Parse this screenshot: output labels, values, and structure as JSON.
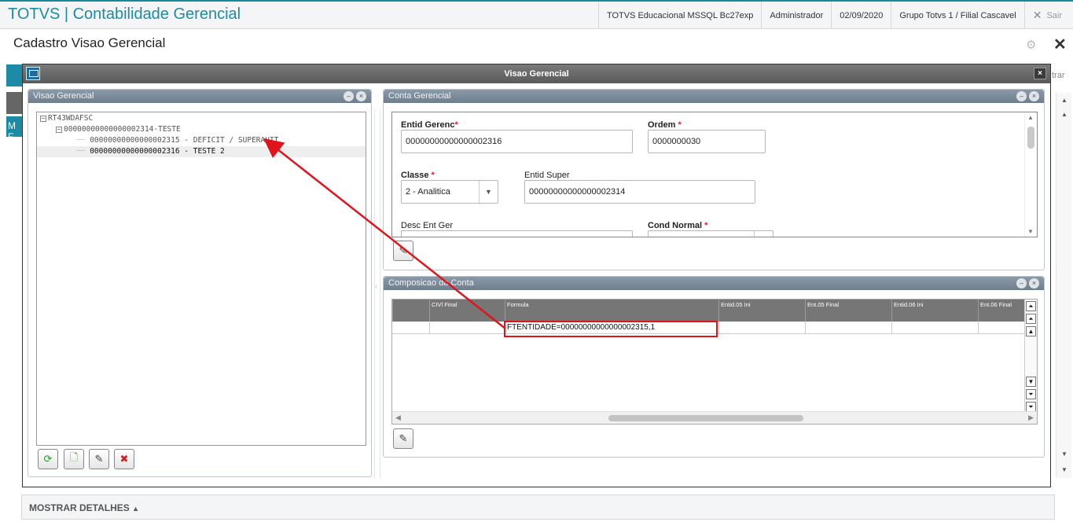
{
  "app": {
    "title": "TOTVS | Contabilidade Gerencial",
    "environment": "TOTVS Educacional MSSQL Bc27exp",
    "user": "Administrador",
    "date": "02/09/2020",
    "branch": "Grupo Totvs 1 / Filial Cascavel",
    "exit_label": "Sair"
  },
  "page": {
    "title": "Cadastro Visao Gerencial",
    "bg_partial_m": "M F",
    "bg_partial_trar": "trar"
  },
  "dialog": {
    "title": "Visao Gerencial",
    "close_glyph": "×"
  },
  "tree_panel": {
    "title": "Visao Gerencial",
    "nodes": [
      {
        "label": "RT43WDAFSC",
        "expander": "−"
      },
      {
        "label": "00000000000000002314-TESTE",
        "expander": "−"
      },
      {
        "label": "00000000000000002315 - DEFICIT / SUPERAVIT"
      },
      {
        "label": "00000000000000002316 - TESTE 2",
        "selected": true
      }
    ]
  },
  "form_panel": {
    "title": "Conta Gerencial",
    "fields": {
      "entid_gerenc": {
        "label": "Entid Gerenc",
        "value": "00000000000000002316"
      },
      "ordem": {
        "label": "Ordem",
        "value": "0000000030"
      },
      "classe": {
        "label": "Classe",
        "value": "2 - Analitica"
      },
      "entid_super": {
        "label": "Entid Super",
        "value": "00000000000000002314"
      },
      "desc_ent_ger": {
        "label": "Desc Ent Ger",
        "value": ""
      },
      "cond_normal": {
        "label": "Cond Normal",
        "value": ""
      }
    },
    "required_marker": "*"
  },
  "composition_panel": {
    "title": "Composicao da Conta",
    "columns": [
      "CIVl Final",
      "Formula",
      "Entid.05 Ini",
      "Ent.05 Final",
      "Entid.06 Ini",
      "Ent.06 Final"
    ],
    "rows": [
      {
        "civl_final": "",
        "formula": "FTENTIDADE=00000000000000002315,1",
        "entid05_ini": "",
        "ent05_final": "",
        "entid06_ini": "",
        "ent06_final": ""
      }
    ]
  },
  "footer": {
    "toggle_label": "MOSTRAR DETALHES"
  },
  "colors": {
    "brand": "#1d8ba6",
    "panel_header": "#7a8896",
    "highlight": "#e0151b"
  }
}
